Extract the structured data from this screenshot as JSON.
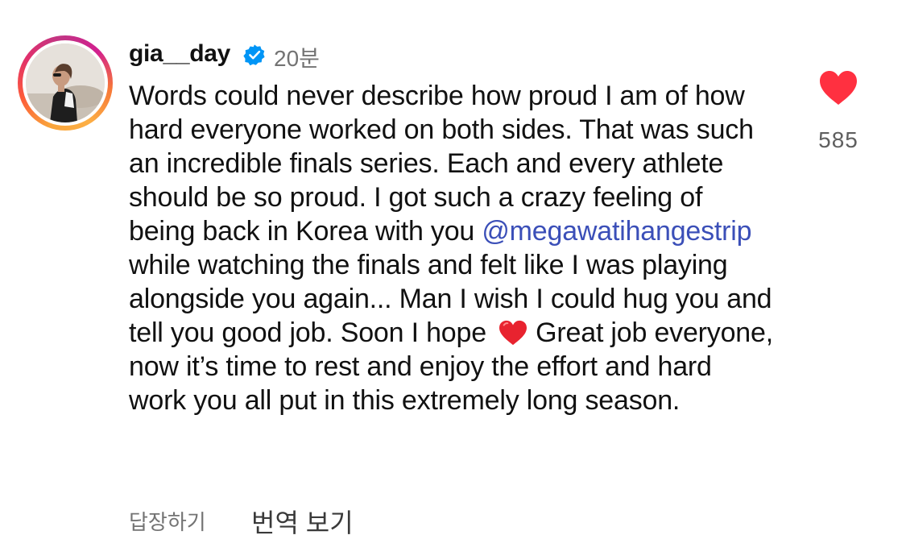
{
  "comment": {
    "author": "gia__day",
    "timestamp": "20분",
    "text_part1": "Words could never describe how proud I am of how hard everyone worked on both sides. That was such an incredible finals series. Each and every athlete should be so proud. I got such a crazy feeling of being back in Korea with you ",
    "mention": "@megawatihangestrip",
    "text_part2": " while watching the finals and felt like I was playing alongside you again... Man I wish I could hug you and tell you good job. Soon I hope",
    "text_part3": "Great job everyone, now it’s time to rest and enjoy the effort and hard work you all put in this extremely long season.",
    "like_count": "585"
  },
  "actions": {
    "reply_label": "답장하기",
    "translate_label": "번역 보기"
  },
  "icons": {
    "verified": "verified-badge-icon",
    "like": "heart-icon",
    "inline_emoji": "red-heart-emoji"
  },
  "colors": {
    "mention": "#3b4fb8",
    "like": "#ff3040",
    "verified": "#0095f6",
    "muted": "#737373"
  }
}
